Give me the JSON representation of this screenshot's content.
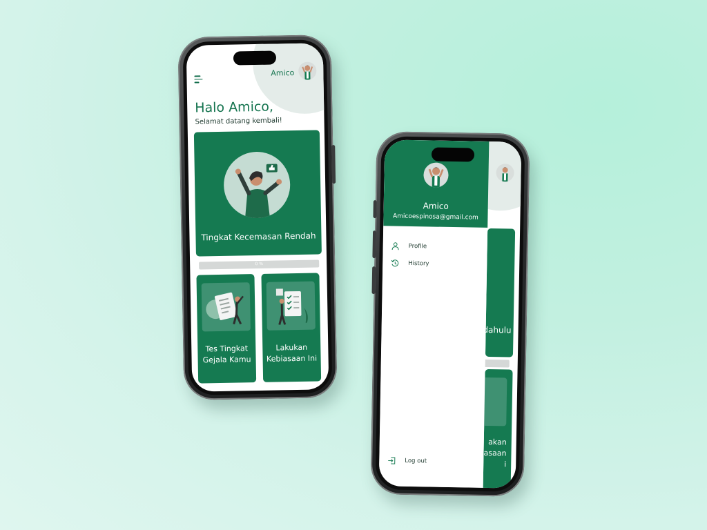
{
  "home": {
    "user_name": "Amico",
    "greeting": "Halo Amico,",
    "subgreeting": "Selamat datang kembali!",
    "hero_title": "Tingkat Kecemasan Rendah",
    "progress_text": "0 %",
    "progress_value": 0,
    "cards": [
      {
        "label": "Tes Tingkat Gejala Kamu"
      },
      {
        "label": "Lakukan Kebiasaan Ini"
      }
    ]
  },
  "drawer": {
    "user_name": "Amico",
    "email": "Amicoespinosa@gmail.com",
    "items": [
      {
        "label": "Profile",
        "icon": "person-icon"
      },
      {
        "label": "History",
        "icon": "history-icon"
      }
    ],
    "logout_label": "Log out",
    "background_texts": {
      "hero": "dahulu",
      "card_lines": [
        "akan",
        "asaan",
        "i"
      ]
    }
  },
  "colors": {
    "primary": "#157a51",
    "card_image_bg": "#3f9172",
    "progress_track": "#d5d8d7",
    "background": "#c2f0e0"
  }
}
